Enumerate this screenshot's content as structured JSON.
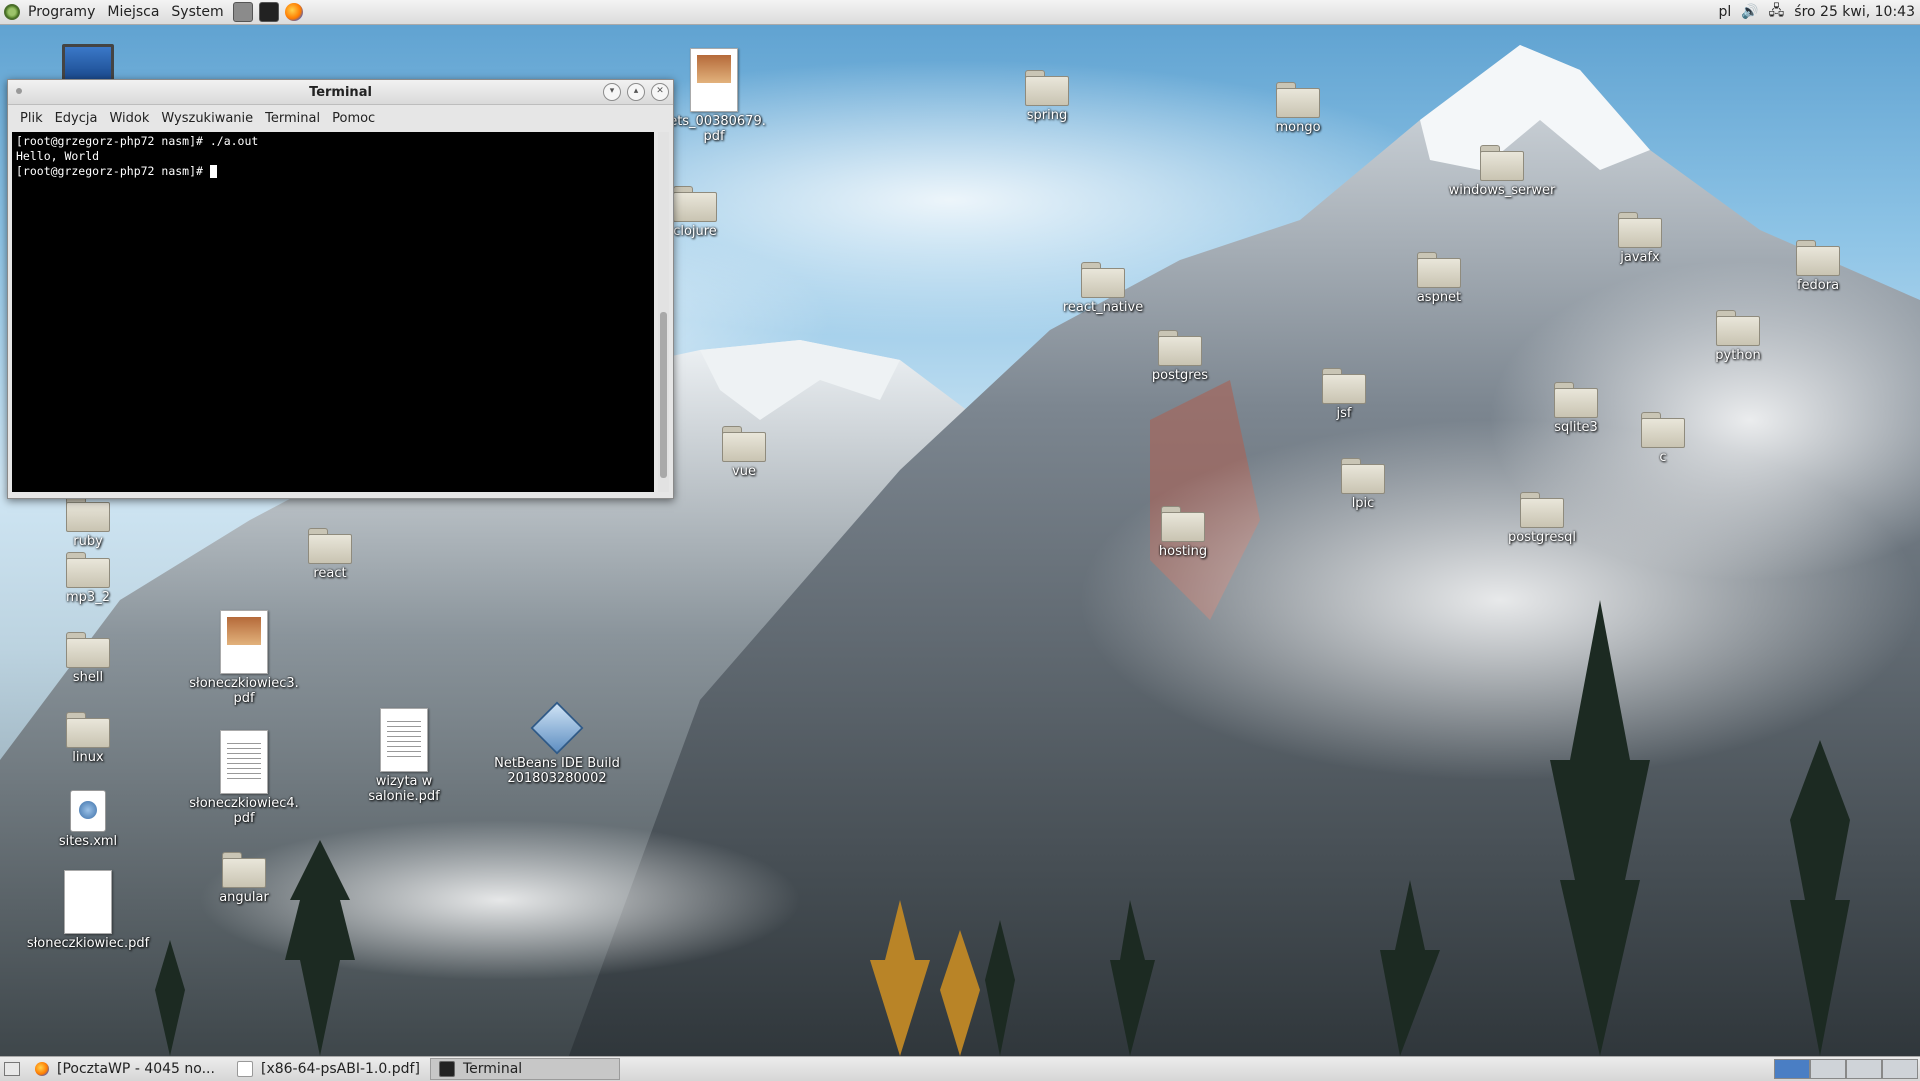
{
  "top_panel": {
    "menus": [
      "Programy",
      "Miejsca",
      "System"
    ],
    "keyboard_layout": "pl",
    "clock": "śro 25 kwi, 10:43"
  },
  "terminal": {
    "title": "Terminal",
    "menu": [
      "Plik",
      "Edycja",
      "Widok",
      "Wyszukiwanie",
      "Terminal",
      "Pomoc"
    ],
    "lines": [
      "[root@grzegorz-php72 nasm]# ./a.out",
      "Hello, World",
      "[root@grzegorz-php72 nasm]# "
    ]
  },
  "desktop_icons": [
    {
      "label": "kets_00380679.\npdf",
      "type": "doc-photo"
    },
    {
      "label": "clojure",
      "type": "folder"
    },
    {
      "label": "spring",
      "type": "folder"
    },
    {
      "label": "mongo",
      "type": "folder"
    },
    {
      "label": "windows_serwer",
      "type": "folder"
    },
    {
      "label": "javafx",
      "type": "folder"
    },
    {
      "label": "fedora",
      "type": "folder"
    },
    {
      "label": "aspnet",
      "type": "folder"
    },
    {
      "label": "react_native",
      "type": "folder"
    },
    {
      "label": "python",
      "type": "folder"
    },
    {
      "label": "postgres",
      "type": "folder"
    },
    {
      "label": "jsf",
      "type": "folder"
    },
    {
      "label": "sqlite3",
      "type": "folder"
    },
    {
      "label": "c",
      "type": "folder"
    },
    {
      "label": "vue",
      "type": "folder"
    },
    {
      "label": "lpic",
      "type": "folder"
    },
    {
      "label": "hosting",
      "type": "folder"
    },
    {
      "label": "postgresql",
      "type": "folder"
    },
    {
      "label": "ruby",
      "type": "folder"
    },
    {
      "label": "react",
      "type": "folder"
    },
    {
      "label": "mp3_2",
      "type": "folder"
    },
    {
      "label": "słoneczkiowiec3.\npdf",
      "type": "doc-photo"
    },
    {
      "label": "shell",
      "type": "folder"
    },
    {
      "label": "linux",
      "type": "folder"
    },
    {
      "label": "wizyta w salonie.pdf",
      "type": "doc-lines"
    },
    {
      "label": "NetBeans IDE Build\n201803280002",
      "type": "netbeans"
    },
    {
      "label": "słoneczkiowiec4.\npdf",
      "type": "doc-lines"
    },
    {
      "label": "sites.xml",
      "type": "xml"
    },
    {
      "label": "angular",
      "type": "folder"
    },
    {
      "label": "słoneczkiowiec.pdf",
      "type": "doc-blank"
    }
  ],
  "taskbar": {
    "tasks": [
      {
        "label": "[PocztaWP - 4045 no...",
        "icon": "firefox-icon",
        "active": false
      },
      {
        "label": "[x86-64-psABI-1.0.pdf]",
        "icon": "document-icon",
        "active": false
      },
      {
        "label": "Terminal",
        "icon": "terminal-icon",
        "active": true
      }
    ],
    "workspace_count": 4,
    "active_workspace": 1
  },
  "colors": {
    "terminal_bg": "#000000",
    "terminal_fg": "#ffffff",
    "workspace_active": "#4a7ec4"
  }
}
